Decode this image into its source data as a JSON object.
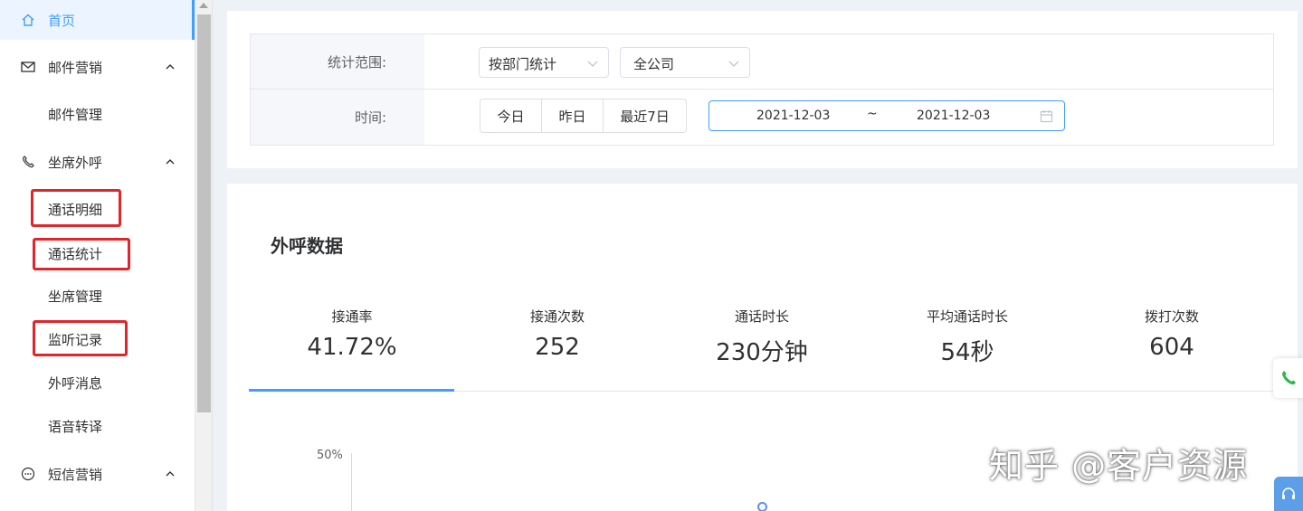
{
  "sidebar": {
    "home": "首页",
    "email_marketing": "邮件营销",
    "email_management": "邮件管理",
    "seat_outbound": "坐席外呼",
    "call_detail": "通话明细",
    "call_stats": "通话统计",
    "seat_management": "坐席管理",
    "monitor_records": "监听记录",
    "outbound_messages": "外呼消息",
    "voice_transcription": "语音转译",
    "sms_marketing": "短信营销"
  },
  "filters": {
    "scope_label": "统计范围:",
    "scope_select": "按部门统计",
    "company_select": "全公司",
    "time_label": "时间:",
    "today": "今日",
    "yesterday": "昨日",
    "last7": "最近7日",
    "start_date": "2021-12-03",
    "separator": "~",
    "end_date": "2021-12-03"
  },
  "outbound": {
    "title": "外呼数据",
    "stats": [
      {
        "label": "接通率",
        "value": "41.72%"
      },
      {
        "label": "接通次数",
        "value": "252"
      },
      {
        "label": "通话时长",
        "value": "230分钟"
      },
      {
        "label": "平均通话时长",
        "value": "54秒"
      },
      {
        "label": "拨打次数",
        "value": "604"
      }
    ],
    "axis_label": "50%"
  },
  "watermark": "知乎 @客户资源",
  "colors": {
    "accent": "#409eff",
    "highlight_box": "#e0262b",
    "phone_icon": "#2db84d"
  }
}
